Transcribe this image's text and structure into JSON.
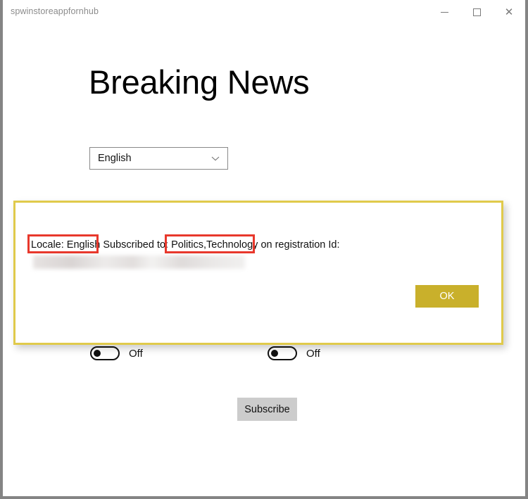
{
  "window": {
    "title": "spwinstoreappfornhub",
    "controls": {
      "minimize": "minimize-icon",
      "maximize": "maximize-icon",
      "close": "✕"
    }
  },
  "page": {
    "heading": "Breaking News"
  },
  "locale_selector": {
    "selected": "English",
    "chevron": "chevron-down-icon"
  },
  "toggles": [
    {
      "name": "politics",
      "label": "Off",
      "state": "off"
    },
    {
      "name": "technology",
      "label": "Off",
      "state": "off"
    }
  ],
  "subscribe": {
    "label": "Subscribe"
  },
  "dialog": {
    "message_parts": {
      "locale": "Locale: English",
      "middle": " Subscribed to: ",
      "topics": "Politics,Technology",
      "tail": " on registration Id:"
    },
    "registration_id": "",
    "ok_label": "OK",
    "border_color": "#e0ca4b",
    "ok_color": "#c9b02b"
  },
  "annotations": {
    "color": "#e8382c",
    "boxes": [
      {
        "name": "locale-highlight",
        "target": "Locale: English"
      },
      {
        "name": "topics-highlight",
        "target": "Politics,Technology"
      }
    ]
  }
}
